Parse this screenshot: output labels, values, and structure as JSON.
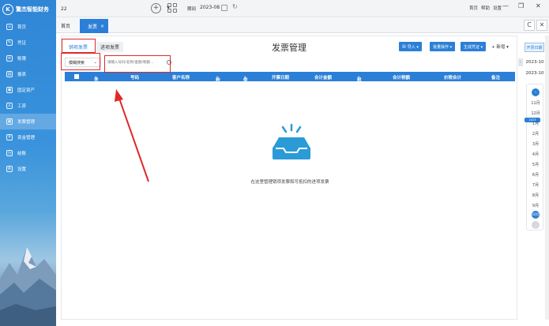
{
  "brand": {
    "name": "驚杰智能财务",
    "logo_letter": "K"
  },
  "sidebar": {
    "items": [
      {
        "label": "首页",
        "icon": "home-icon",
        "glyph": "⌂"
      },
      {
        "label": "凭证",
        "icon": "voucher-icon",
        "glyph": "✎"
      },
      {
        "label": "账簿",
        "icon": "ledger-icon",
        "glyph": "≡"
      },
      {
        "label": "报表",
        "icon": "report-icon",
        "glyph": "▤"
      },
      {
        "label": "固定资产",
        "icon": "asset-icon",
        "glyph": "▣"
      },
      {
        "label": "工资",
        "icon": "salary-icon",
        "glyph": "♙"
      },
      {
        "label": "发票管理",
        "icon": "invoice-icon",
        "glyph": "▦",
        "active": true
      },
      {
        "label": "资金管理",
        "icon": "fund-icon",
        "glyph": "¥"
      },
      {
        "label": "结账",
        "icon": "closing-icon",
        "glyph": "◷"
      },
      {
        "label": "设置",
        "icon": "settings-icon",
        "glyph": "⚙"
      }
    ]
  },
  "topbar": {
    "account_value": "22",
    "add_glyph": "+",
    "period_label": "期间",
    "period_value": "2023-08",
    "refresh_glyph": "↻",
    "links": [
      "首页",
      "帮助",
      "设置"
    ],
    "win_min": "—",
    "win_max": "❐",
    "win_close": "✕"
  },
  "tabs": {
    "home": "首页",
    "invoice": "发票",
    "close": "×"
  },
  "tab_controls": {
    "refresh": "C",
    "close": "✕"
  },
  "main": {
    "subtab_sales": "销项发票",
    "subtab_purchase": "进项发票",
    "title": "发票管理",
    "buttons": {
      "import": "导入 ▾",
      "batch": "批量操作 ▾",
      "voucher": "生成凭证 ▾",
      "new": "+ 新增 ▾"
    },
    "search_type": "模糊搜索",
    "search_placeholder": "请输入号码/名称/金额/税额..."
  },
  "table": {
    "headers": [
      "凭证",
      "号码",
      "客户名称",
      "种类",
      "类型",
      "开票日期",
      "合计金额",
      "税率",
      "合计税额",
      "价税合计",
      "备注"
    ]
  },
  "empty_state": {
    "text": "在这里管理销项发票和可抵扣的进项发票"
  },
  "date_rail": {
    "button": "开票日期",
    "range_start": "2023-10",
    "range_end": "2023-10",
    "up_glyph": "⌃",
    "year_badge": "2023",
    "months": [
      "11月",
      "12月",
      "1月",
      "2月",
      "3月",
      "4月",
      "5月",
      "6月",
      "7月",
      "8月",
      "9月"
    ],
    "selected": "10月",
    "down_glyph": "⌄"
  },
  "colors": {
    "accent": "#2b7fd6",
    "annotation": "#e02828"
  }
}
